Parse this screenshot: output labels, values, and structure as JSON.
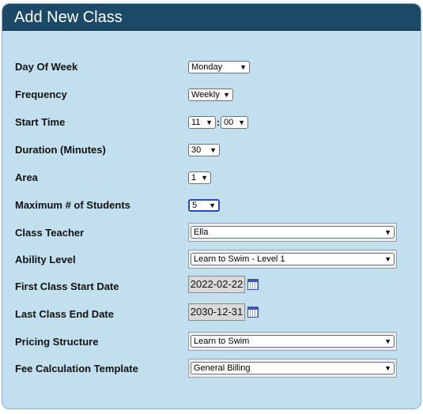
{
  "title": "Add New Class",
  "fields": {
    "day_of_week": {
      "label": "Day Of Week",
      "value": "Monday"
    },
    "frequency": {
      "label": "Frequency",
      "value": "Weekly"
    },
    "start_time": {
      "label": "Start Time",
      "hour": "11",
      "separator": ":",
      "minute": "00"
    },
    "duration": {
      "label": "Duration (Minutes)",
      "value": "30"
    },
    "area": {
      "label": "Area",
      "value": "1"
    },
    "max_students": {
      "label": "Maximum # of Students",
      "value": "5"
    },
    "class_teacher": {
      "label": "Class Teacher",
      "value": "Ella"
    },
    "ability_level": {
      "label": "Ability Level",
      "value": "Learn to Swim - Level 1"
    },
    "first_class_start": {
      "label": "First Class Start Date",
      "value": "2022-02-22"
    },
    "last_class_end": {
      "label": "Last Class End Date",
      "value": "2030-12-31"
    },
    "pricing_structure": {
      "label": "Pricing Structure",
      "value": "Learn to Swim"
    },
    "fee_template": {
      "label": "Fee Calculation Template",
      "value": "General Billing"
    }
  },
  "icons": {
    "dropdown": "chevron-down-icon",
    "calendar": "calendar-icon"
  },
  "colors": {
    "header_bg": "#1c4a66",
    "panel_bg": "#c2dff0",
    "focus_border": "#2a4bbd"
  }
}
